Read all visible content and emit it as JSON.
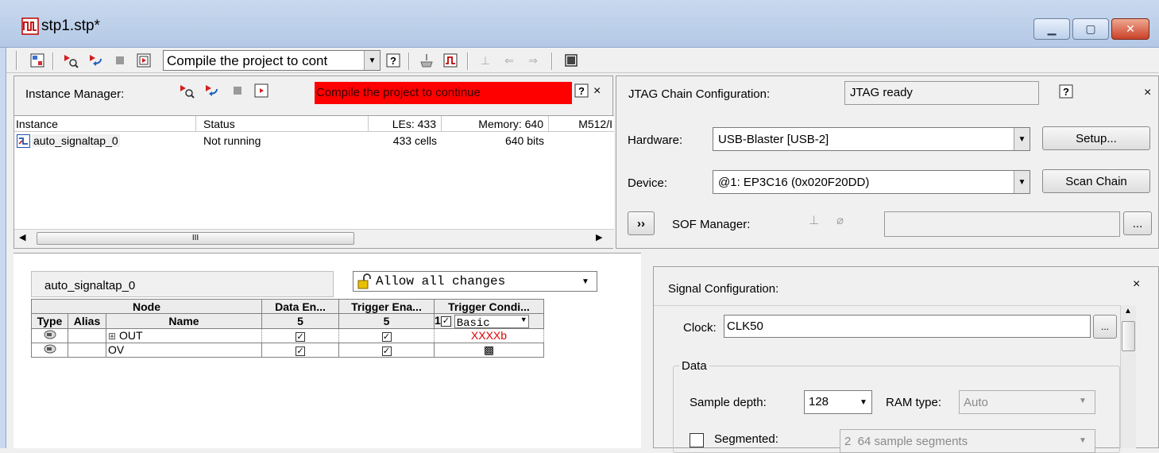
{
  "window": {
    "title": "stp1.stp*",
    "minimize_label": "▁",
    "maximize_label": "▢",
    "close_label": "✕"
  },
  "toolbar": {
    "status_combo_value": "Compile the project to cont"
  },
  "instance_manager": {
    "label": "Instance Manager:",
    "status_message": "Compile the project to continue",
    "columns": [
      "Instance",
      "Status",
      "LEs: 433",
      "Memory: 640",
      "M512/I"
    ],
    "rows": [
      {
        "instance": "auto_signaltap_0",
        "status": "Not running",
        "les": "433 cells",
        "memory": "640 bits"
      }
    ],
    "scroll_mid": "III"
  },
  "jtag": {
    "label": "JTAG Chain Configuration:",
    "status": "JTAG ready",
    "hardware_label": "Hardware:",
    "hardware_value": "USB-Blaster [USB-2]",
    "setup_label": "Setup...",
    "device_label": "Device:",
    "device_value": "@1: EP3C16 (0x020F20DD)",
    "scan_chain_label": "Scan Chain",
    "expand_label": "››",
    "sof_label": "SOF Manager:",
    "sof_browse_label": "...",
    "close_label": "×",
    "help_label": "?"
  },
  "node_list": {
    "tab_label": "auto_signaltap_0",
    "lock_combo_value": "Allow all changes",
    "header_node": "Node",
    "header_data_enable": "Data En...",
    "header_trigger_enable": "Trigger Ena...",
    "header_trigger_cond": "Trigger Condi...",
    "header_type": "Type",
    "header_alias": "Alias",
    "header_name": "Name",
    "data_enable_count": "5",
    "trigger_enable_count": "5",
    "trigger_level": "1",
    "trigger_mode": "Basic",
    "rows": [
      {
        "name": "OUT",
        "expander": "⊞",
        "trigger_condition": "XXXXb"
      },
      {
        "name": "OV",
        "expander": "",
        "trigger_condition": "▩"
      }
    ]
  },
  "signal_config": {
    "label": "Signal Configuration:",
    "close_label": "×",
    "clock_label": "Clock:",
    "clock_value": "CLK50",
    "clock_browse_label": "...",
    "data_group_label": "Data",
    "sample_depth_label": "Sample depth:",
    "sample_depth_value": "128",
    "ram_type_label": "RAM type:",
    "ram_type_value": "Auto",
    "segmented_label": "Segmented:",
    "segments_value": "2  64 sample segments"
  },
  "colors": {
    "error_bar": "#ff0000",
    "trigger_cond_text": "#e00000",
    "titlebar": "#c9d9ee"
  }
}
